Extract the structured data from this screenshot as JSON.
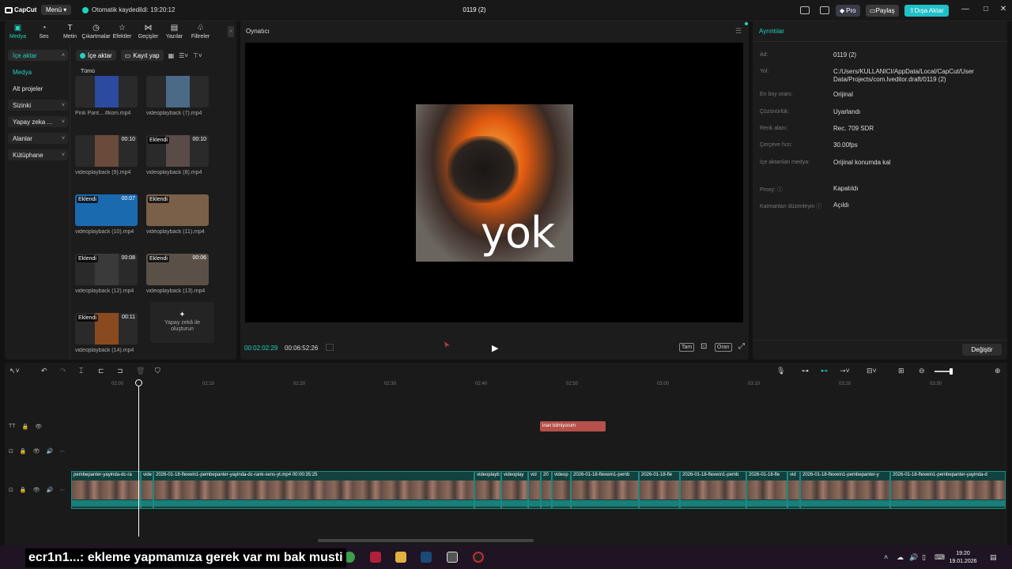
{
  "titlebar": {
    "logo": "CapCut",
    "menu_label": "Menü",
    "autosave_text": "Otomatik kaydedildi: 19:20:12",
    "project_title": "0119 (2)",
    "pro_label": "Pro",
    "share_label": "Paylaş",
    "export_label": "Dışa Aktar"
  },
  "tools": [
    {
      "label": "Medya",
      "glyph": "▣",
      "active": true
    },
    {
      "label": "Ses",
      "glyph": "◔"
    },
    {
      "label": "Metin",
      "glyph": "T"
    },
    {
      "label": "Çıkartmalar",
      "glyph": "◷"
    },
    {
      "label": "Efektler",
      "glyph": "☆"
    },
    {
      "label": "Geçişler",
      "glyph": "⋈"
    },
    {
      "label": "Yazılar",
      "glyph": "▤"
    },
    {
      "label": "Filtreler",
      "glyph": "♧"
    }
  ],
  "side_nav": {
    "import": "İçe aktar",
    "media": "Medya",
    "subprojects": "Alt projeler",
    "yours": "Sizinki",
    "ai": "Yapay zeka ...",
    "spaces": "Alanlar",
    "library": "Kütüphane"
  },
  "media_toolbar": {
    "import_label": "İçe aktar",
    "record_label": "Kayıt yap"
  },
  "all_label": "Tümü",
  "media": [
    {
      "name": "Pink Pant... #kom.mp4",
      "badge": "",
      "duration": ""
    },
    {
      "name": "videoplayback (7).mp4",
      "badge": "",
      "duration": ""
    },
    {
      "name": "videoplayback (9).mp4",
      "badge": "",
      "duration": "00:10"
    },
    {
      "name": "videoplayback (8).mp4",
      "badge": "Eklendi",
      "duration": "00:10"
    },
    {
      "name": "videoplayback (10).mp4",
      "badge": "Eklendi",
      "duration": "00:07"
    },
    {
      "name": "videoplayback (11).mp4",
      "badge": "Eklendi",
      "duration": ""
    },
    {
      "name": "videoplayback (12).mp4",
      "badge": "Eklendi",
      "duration": "00:08"
    },
    {
      "name": "videoplayback (13).mp4",
      "badge": "Eklendi",
      "duration": "00:06"
    },
    {
      "name": "videoplayback (14).mp4",
      "badge": "Eklendi",
      "duration": "00:11"
    }
  ],
  "ai_create_label": "Yapay zekâ ile oluşturun",
  "player": {
    "title": "Oynatıcı",
    "frame_text": "yok",
    "current_time": "00:02:02:29",
    "total_time": "00:06:52:26",
    "fullscreen_label": "Tam",
    "ratio_label": "Oran"
  },
  "details": {
    "title": "Ayrıntılar",
    "rows": [
      {
        "label": "Ad:",
        "value": "0119 (2)"
      },
      {
        "label": "Yol:",
        "value": "C:/Users/KULLANICI/AppData/Local/CapCut/User Data/Projects/com.lveditor.draft/0119 (2)"
      },
      {
        "label": "En boy oranı:",
        "value": "Orijinal"
      },
      {
        "label": "Çözünürlük:",
        "value": "Uyarlandı"
      },
      {
        "label": "Renk alanı:",
        "value": "Rec. 709 SDR"
      },
      {
        "label": "Çerçeve hızı:",
        "value": "30.00fps"
      },
      {
        "label": "İçe aktarılan medya:",
        "value": "Orijinal konumda kal"
      },
      {
        "label": "Proxy: ⓘ",
        "value": "Kapatıldı"
      },
      {
        "label": "Katmanları düzenleyin ⓘ",
        "value": "Açıldı"
      }
    ],
    "change_label": "Değiştir"
  },
  "timeline": {
    "ticks": [
      "02:00",
      "02:10",
      "02:20",
      "02:30",
      "02:40",
      "02:50",
      "03:00",
      "03:10",
      "03:20",
      "03:30"
    ],
    "text_clip": "inan bilmiyorum",
    "clips": [
      {
        "label": "pembepanter-yayinda-dc-ra"
      },
      {
        "label": "vide"
      },
      {
        "label": "2026-01-18-flexwin1-pembepanter-yayinda-dc-rank-sens-yt.mp4  00:00:35:25"
      },
      {
        "label": "videoplayb"
      },
      {
        "label": "videoplay"
      },
      {
        "label": "vid"
      },
      {
        "label": "20"
      },
      {
        "label": "videop"
      },
      {
        "label": "2026-01-18-flexwin1-pemb"
      },
      {
        "label": "2026-01-18-fle"
      },
      {
        "label": "2026-01-18-flexwin1-pemb"
      },
      {
        "label": "2026-01-18-fle"
      },
      {
        "label": "vid"
      },
      {
        "label": "2026-01-18-flexwin1-pembepanter-y"
      },
      {
        "label": "2026-01-18-flexwin1-pembepanter-yayinda-d"
      }
    ]
  },
  "taskbar": {
    "subtitle": "ecr1n1...: ekleme yapmamıza gerek var mı bak musti",
    "time": "19:20",
    "date": "19.01.2026"
  },
  "colors": {
    "accent": "#20d3c2",
    "text_clip": "#b6504a",
    "clip_bg": "#11423f"
  }
}
